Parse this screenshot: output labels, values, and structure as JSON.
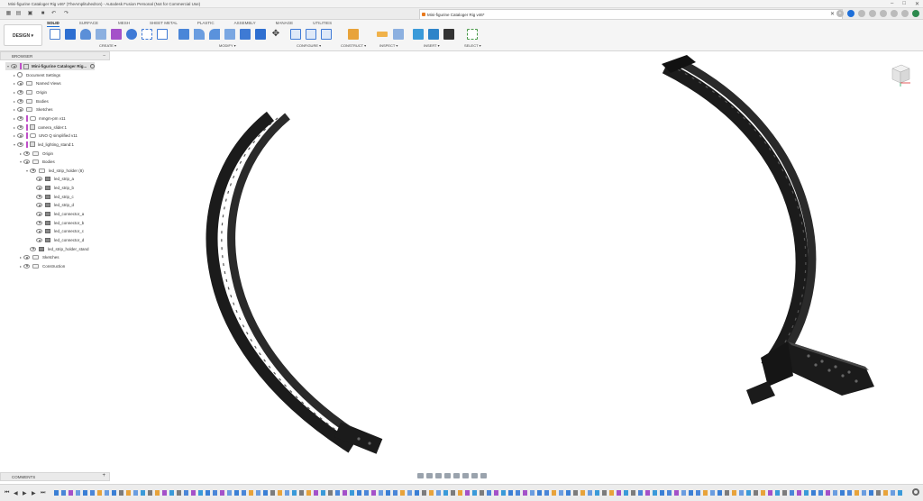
{
  "app": {
    "title": "Mini-figurine Cataloger Rig v46* (TheAmplituhedron) - Autodesk Fusion Personal (Not for Commercial Use)",
    "window_controls": [
      "–",
      "□",
      "✕"
    ]
  },
  "doc_tab": {
    "label": "Mini-figurine Cataloger Rig v46*",
    "close": "✕"
  },
  "ribbon": {
    "design_button": "DESIGN ▾",
    "tabs": [
      "SOLID",
      "SURFACE",
      "MESH",
      "SHEET METAL",
      "PLASTIC",
      "ASSEMBLY",
      "MANAGE",
      "UTILITIES"
    ],
    "active_tab": "SOLID",
    "groups": [
      "CREATE ▾",
      "MODIFY ▾",
      "CONFIGURE ▾",
      "CONSTRUCT ▾",
      "INSPECT ▾",
      "INSERT ▾",
      "SELECT ▾"
    ]
  },
  "browser": {
    "header": "BROWSER",
    "root": "Mini-figurine Cataloger Rig...",
    "items": [
      {
        "label": "Document Settings",
        "type": "gear",
        "level": 1
      },
      {
        "label": "Named Views",
        "type": "folder",
        "level": 1
      },
      {
        "label": "Origin",
        "type": "folder",
        "level": 1
      },
      {
        "label": "Bodies",
        "type": "folder",
        "level": 1
      },
      {
        "label": "Sketches",
        "type": "folder",
        "level": 1
      },
      {
        "label": "mmgm-pm v11",
        "type": "link",
        "level": 1
      },
      {
        "label": "camera_slider:1",
        "type": "comp",
        "level": 1
      },
      {
        "label": "UNO Q simplified v11",
        "type": "link",
        "level": 1
      },
      {
        "label": "led_lighting_stand:1",
        "type": "comp",
        "level": 1
      },
      {
        "label": "Origin",
        "type": "folder",
        "level": 2
      },
      {
        "label": "Bodies",
        "type": "folder",
        "level": 2
      },
      {
        "label": "led_strip_holder (8)",
        "type": "folder",
        "level": 3
      },
      {
        "label": "led_strip_a",
        "type": "body",
        "level": 4
      },
      {
        "label": "led_strip_b",
        "type": "body",
        "level": 4
      },
      {
        "label": "led_strip_c",
        "type": "body",
        "level": 4
      },
      {
        "label": "led_strip_d",
        "type": "body",
        "level": 4
      },
      {
        "label": "led_connector_a",
        "type": "body",
        "level": 4
      },
      {
        "label": "led_connector_b",
        "type": "body",
        "level": 4
      },
      {
        "label": "led_connector_c",
        "type": "body",
        "level": 4
      },
      {
        "label": "led_connector_d",
        "type": "body",
        "level": 4
      },
      {
        "label": "led_strip_holder_stand",
        "type": "body",
        "level": 3
      },
      {
        "label": "Sketches",
        "type": "folder",
        "level": 2
      },
      {
        "label": "Construction",
        "type": "folder",
        "level": 2
      }
    ]
  },
  "comments": {
    "label": "COMMENTS",
    "add": "+"
  },
  "colors": {
    "accent": "#1e6fd9",
    "model": "#1b1b1b",
    "component_marker": "#c050c8"
  }
}
